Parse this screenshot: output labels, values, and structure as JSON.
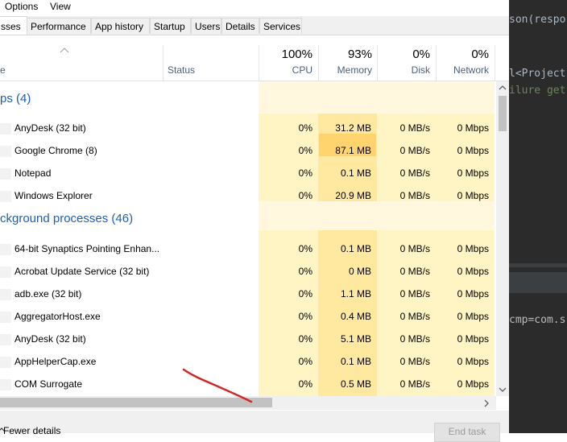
{
  "menu": {
    "items": [
      "Options",
      "View"
    ]
  },
  "tabs": [
    "sses",
    "Performance",
    "App history",
    "Startup",
    "Users",
    "Details",
    "Services"
  ],
  "header": {
    "name_col": "e",
    "status_col": "Status",
    "cpu_pct": "100%",
    "cpu_label": "CPU",
    "mem_pct": "93%",
    "mem_label": "Memory",
    "disk_pct": "0%",
    "disk_label": "Disk",
    "net_pct": "0%",
    "net_label": "Network"
  },
  "groups": {
    "apps": "ps (4)",
    "background": "ckground processes (46)"
  },
  "rows": [
    {
      "name": "AnyDesk (32 bit)",
      "cpu": "0%",
      "mem": "31.2 MB",
      "disk": "0 MB/s",
      "net": "0 Mbps"
    },
    {
      "name": "Google Chrome (8)",
      "cpu": "0%",
      "mem": "87.1 MB",
      "disk": "0 MB/s",
      "net": "0 Mbps"
    },
    {
      "name": "Notepad",
      "cpu": "0%",
      "mem": "0.1 MB",
      "disk": "0 MB/s",
      "net": "0 Mbps"
    },
    {
      "name": "Windows Explorer",
      "cpu": "0%",
      "mem": "20.9 MB",
      "disk": "0 MB/s",
      "net": "0 Mbps"
    },
    {
      "name": "64-bit Synaptics Pointing Enhan...",
      "cpu": "0%",
      "mem": "0.1 MB",
      "disk": "0 MB/s",
      "net": "0 Mbps"
    },
    {
      "name": "Acrobat Update Service (32 bit)",
      "cpu": "0%",
      "mem": "0 MB",
      "disk": "0 MB/s",
      "net": "0 Mbps"
    },
    {
      "name": "adb.exe (32 bit)",
      "cpu": "0%",
      "mem": "1.1 MB",
      "disk": "0 MB/s",
      "net": "0 Mbps"
    },
    {
      "name": "AggregatorHost.exe",
      "cpu": "0%",
      "mem": "0.4 MB",
      "disk": "0 MB/s",
      "net": "0 Mbps"
    },
    {
      "name": "AnyDesk (32 bit)",
      "cpu": "0%",
      "mem": "5.1 MB",
      "disk": "0 MB/s",
      "net": "0 Mbps"
    },
    {
      "name": "AppHelperCap.exe",
      "cpu": "0%",
      "mem": "0.1 MB",
      "disk": "0 MB/s",
      "net": "0 Mbps"
    },
    {
      "name": "COM Surrogate",
      "cpu": "0%",
      "mem": "0.5 MB",
      "disk": "0 MB/s",
      "net": "0 Mbps"
    }
  ],
  "footer": {
    "fewer": "Fewer details",
    "end_task": "End task"
  },
  "editor": {
    "lines": [
      "son(respo",
      "l<Project",
      "ilure get",
      "cmp=com.s"
    ]
  },
  "colors": {
    "heat_light": "#fff4c4",
    "heat_mid": "#ffe9a1",
    "heat_high": "#ffd46e",
    "group_blue": "#1e5fb3",
    "annotation": "#d42525"
  }
}
